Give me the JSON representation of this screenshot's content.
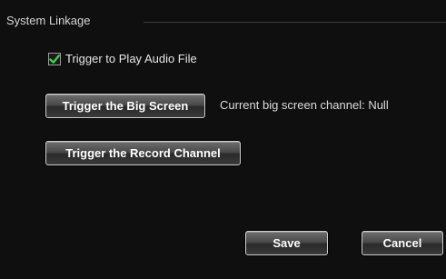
{
  "section": {
    "legend": "System Linkage"
  },
  "audio": {
    "label": "Trigger to Play Audio File",
    "checked": true,
    "check_color": "#3cd246"
  },
  "big_screen": {
    "button_label": "Trigger the Big Screen",
    "status_text": "Current big screen channel: Null"
  },
  "record": {
    "button_label": "Trigger the Record Channel"
  },
  "footer": {
    "save_label": "Save",
    "cancel_label": "Cancel"
  }
}
